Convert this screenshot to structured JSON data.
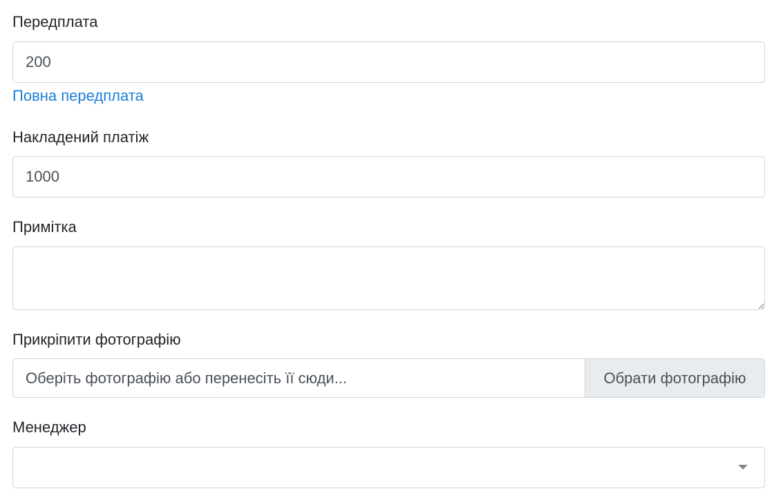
{
  "prepayment": {
    "label": "Передплата",
    "value": "200",
    "full_prepayment_link": "Повна передплата"
  },
  "cod_payment": {
    "label": "Накладений платіж",
    "value": "1000"
  },
  "note": {
    "label": "Примітка",
    "value": ""
  },
  "photo": {
    "label": "Прикріпити фотографію",
    "placeholder": "Оберіть фотографію або перенесіть її сюди...",
    "button_label": "Обрати фотографію"
  },
  "manager": {
    "label": "Менеджер",
    "selected": "",
    "icon": "chevron-down-icon"
  }
}
